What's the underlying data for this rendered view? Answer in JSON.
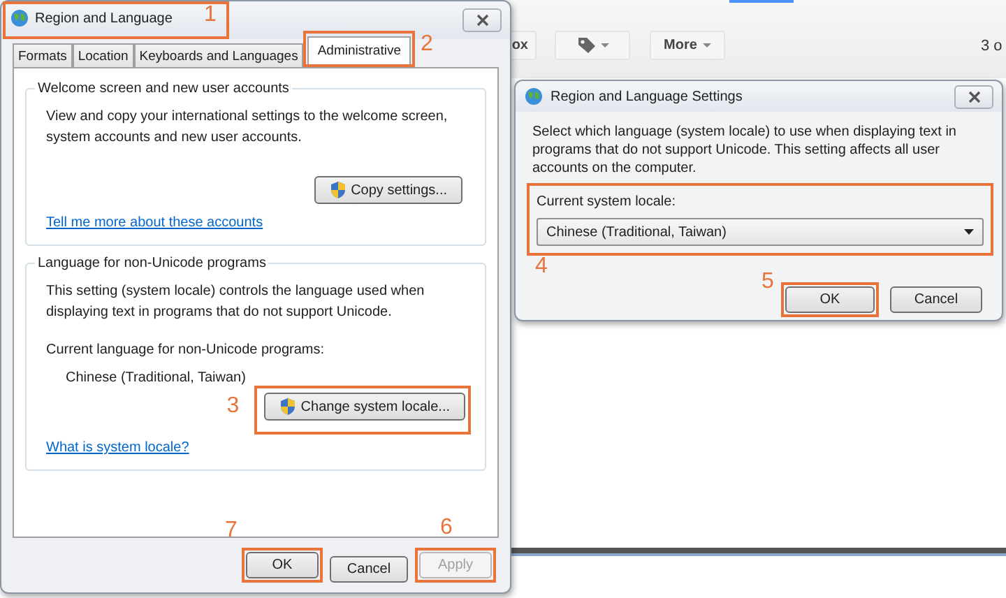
{
  "background_page": {
    "toolbar": [
      {
        "kind": "text",
        "label": "ox"
      },
      {
        "kind": "tag-menu"
      },
      {
        "kind": "menu",
        "label": "More"
      }
    ],
    "page_count": "3 o"
  },
  "main_dialog": {
    "title": "Region and Language",
    "title_callout": "1",
    "tabs": [
      {
        "label": "Formats",
        "selected": false
      },
      {
        "label": "Location",
        "selected": false
      },
      {
        "label": "Keyboards and Languages",
        "selected": false
      },
      {
        "label": "Administrative",
        "selected": true,
        "callout": "2"
      }
    ],
    "groups": [
      {
        "title": "Welcome screen and new user accounts",
        "description": "View and copy your international settings to the welcome screen, system accounts and new user accounts.",
        "button": {
          "label": "Copy settings..."
        },
        "link": "Tell me more about these accounts"
      },
      {
        "title": "Language for non-Unicode programs",
        "description": "This setting (system locale) controls the language used when displaying text in programs that do not support Unicode.",
        "current_label": "Current language for non-Unicode programs:",
        "current_value": "Chinese (Traditional, Taiwan)",
        "button": {
          "label": "Change system locale...",
          "callout": "3"
        },
        "link": "What is system locale?"
      }
    ],
    "buttons": [
      {
        "label": "OK",
        "disabled": false,
        "callout": "7"
      },
      {
        "label": "Cancel",
        "disabled": false
      },
      {
        "label": "Apply",
        "disabled": true,
        "callout": "6"
      }
    ]
  },
  "settings_dialog": {
    "title": "Region and Language Settings",
    "description": "Select which language (system locale) to use when displaying text in programs that do not support Unicode. This setting affects all user accounts on the computer.",
    "locale_label": "Current system locale:",
    "locale_value": "Chinese (Traditional, Taiwan)",
    "locale_callout": "4",
    "buttons": [
      {
        "label": "OK",
        "callout": "5"
      },
      {
        "label": "Cancel"
      }
    ]
  }
}
